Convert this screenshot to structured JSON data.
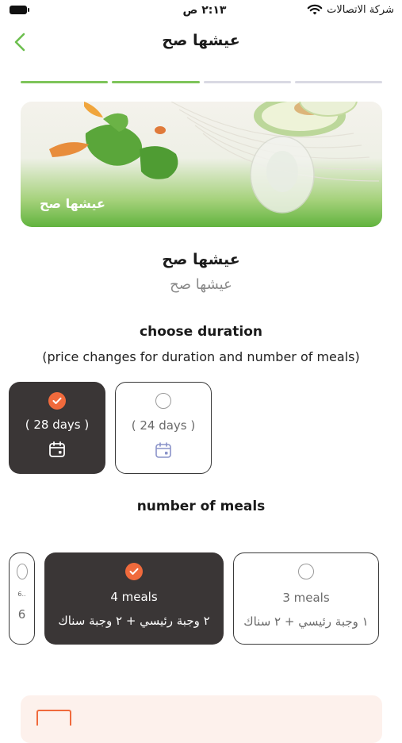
{
  "status_bar": {
    "time": "٢:١٣ ص",
    "carrier": "شركة الاتصالات"
  },
  "nav": {
    "title": "عيشها صح"
  },
  "progress": {
    "total_steps": 4,
    "completed_steps": 2,
    "active_color": "#7ec45a",
    "inactive_color": "#d9d9e3"
  },
  "banner": {
    "label": "عيشها صح"
  },
  "package": {
    "title": "عيشها صح",
    "subtitle": "عيشها صح"
  },
  "duration": {
    "heading": "choose duration",
    "note": "(price changes for duration and number of meals)",
    "options": [
      {
        "label": "( 28 days )",
        "selected": true
      },
      {
        "label": "( 24 days )",
        "selected": false
      }
    ]
  },
  "meals": {
    "heading": "number of meals",
    "options": [
      {
        "label": "6..",
        "sub": "6",
        "selected": false
      },
      {
        "label": "4 meals",
        "sub": "٢ وجبة رئيسي + ٢ وجبة سناك",
        "selected": true
      },
      {
        "label": "3 meals",
        "sub": "١ وجبة رئيسي + ٢ سناك",
        "selected": false
      }
    ]
  },
  "colors": {
    "accent": "#f06a3c",
    "brand_green": "#7ec45a",
    "selected_card": "#3a3636"
  }
}
